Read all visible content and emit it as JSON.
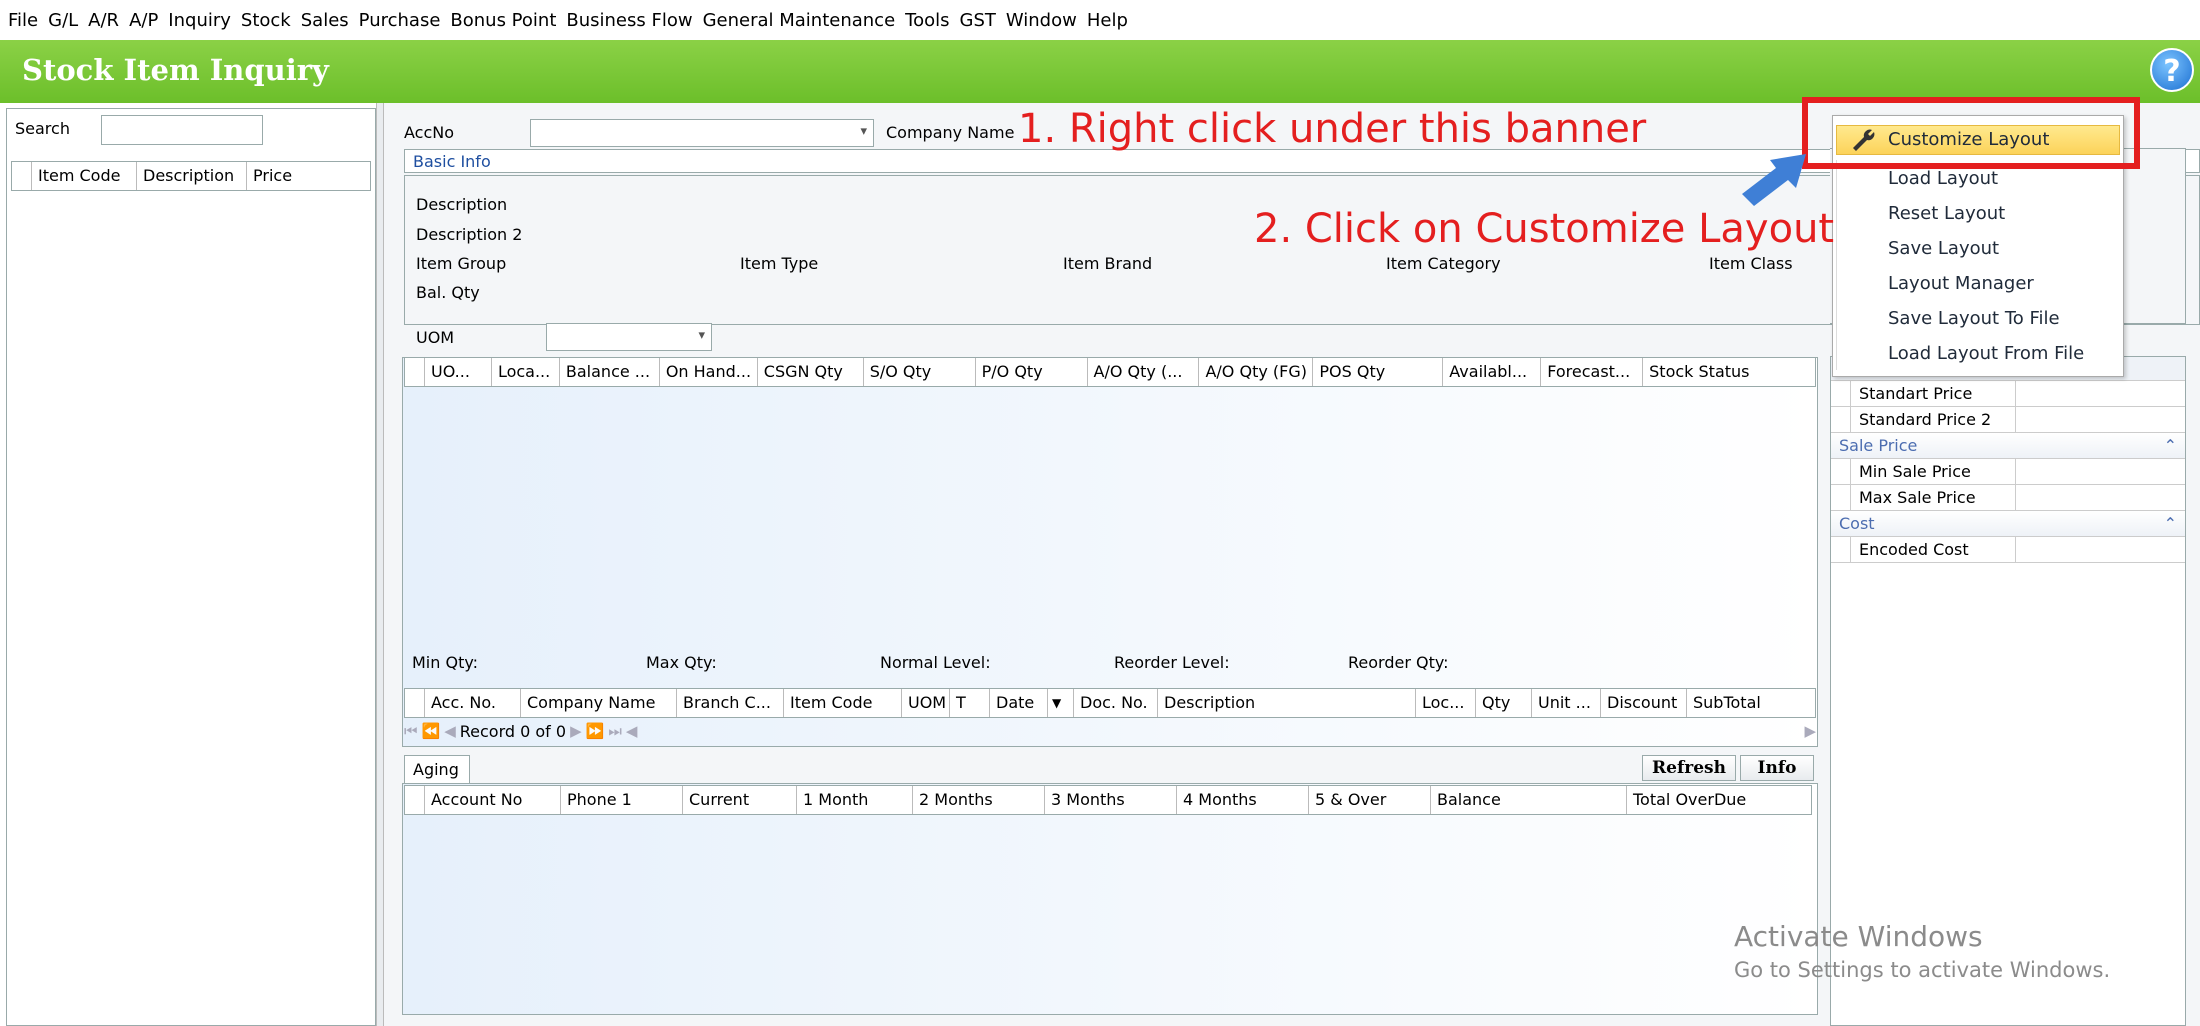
{
  "menu": [
    "File",
    "G/L",
    "A/R",
    "A/P",
    "Inquiry",
    "Stock",
    "Sales",
    "Purchase",
    "Bonus Point",
    "Business Flow",
    "General Maintenance",
    "Tools",
    "GST",
    "Window",
    "Help"
  ],
  "window": {
    "title": "Stock Item Inquiry",
    "help_icon": "?"
  },
  "left_panel": {
    "search_label": "Search",
    "search_value": "",
    "columns": [
      "Item Code",
      "Description",
      "Price"
    ]
  },
  "header": {
    "accno_label": "AccNo",
    "company_name_label": "Company Name",
    "accno_value": ""
  },
  "basic_info": {
    "group_label": "Basic Info",
    "description": "Description",
    "description2": "Description 2",
    "item_group": "Item Group",
    "item_type": "Item Type",
    "item_brand": "Item Brand",
    "item_category": "Item Category",
    "item_class": "Item Class",
    "bal_qty": "Bal. Qty"
  },
  "uom": {
    "label": "UOM",
    "value": ""
  },
  "stock_grid_columns": [
    "UO...",
    "Loca...",
    "Balance ...",
    "On Hand...",
    "CSGN Qty",
    "S/O Qty",
    "P/O Qty",
    "A/O Qty (...",
    "A/O Qty (FG)",
    "POS Qty",
    "Availabl...",
    "Forecast...",
    "Stock Status"
  ],
  "levels": {
    "min_qty": "Min Qty:",
    "max_qty": "Max Qty:",
    "normal_level": "Normal Level:",
    "reorder_level": "Reorder Level:",
    "reorder_qty": "Reorder Qty:"
  },
  "txn_grid_columns": [
    "Acc. No.",
    "Company Name",
    "Branch C...",
    "Item Code",
    "UOM",
    "T",
    "Date",
    "Doc. No.",
    "Description",
    "Loc...",
    "Qty",
    "Unit ...",
    "Discount",
    "SubTotal"
  ],
  "navigator": {
    "record_text": "Record 0 of 0",
    "first": "⏮",
    "prev_page": "⏪",
    "prev": "◀",
    "next": "▶",
    "next_page": "⏩",
    "last": "⏭",
    "scroll_left": "◀",
    "scroll_right": "▶"
  },
  "aging": {
    "tab_label": "Aging",
    "refresh_label": "Refresh",
    "info_label": "Info",
    "columns": [
      "Account No",
      "Phone 1",
      "Current",
      "1 Month",
      "2 Months",
      "3 Months",
      "4 Months",
      "5 & Over",
      "Balance",
      "Total OverDue"
    ]
  },
  "context_menu": {
    "items": [
      "Customize Layout",
      "Load Layout",
      "Reset Layout",
      "Save Layout",
      "Layout Manager",
      "Save Layout To File",
      "Load Layout From File"
    ],
    "selected_index": 0,
    "selected_icon": "wrench-icon"
  },
  "properties": {
    "rows_top": [
      "Standart Price",
      "Standard Price 2"
    ],
    "categories": [
      {
        "name": "Sale Price",
        "collapse_icon": "⌃",
        "rows": [
          "Min Sale Price",
          "Max Sale Price"
        ]
      },
      {
        "name": "Cost",
        "collapse_icon": "⌃",
        "rows": [
          "Encoded Cost"
        ]
      }
    ]
  },
  "annotations": {
    "step1": "1. Right click under this banner",
    "step2": "2. Click on Customize Layout",
    "arrow_color": "#3f7fd6",
    "highlight_color": "#e41f1f"
  },
  "watermark": {
    "line1": "Activate Windows",
    "line2": "Go to Settings to activate Windows."
  }
}
